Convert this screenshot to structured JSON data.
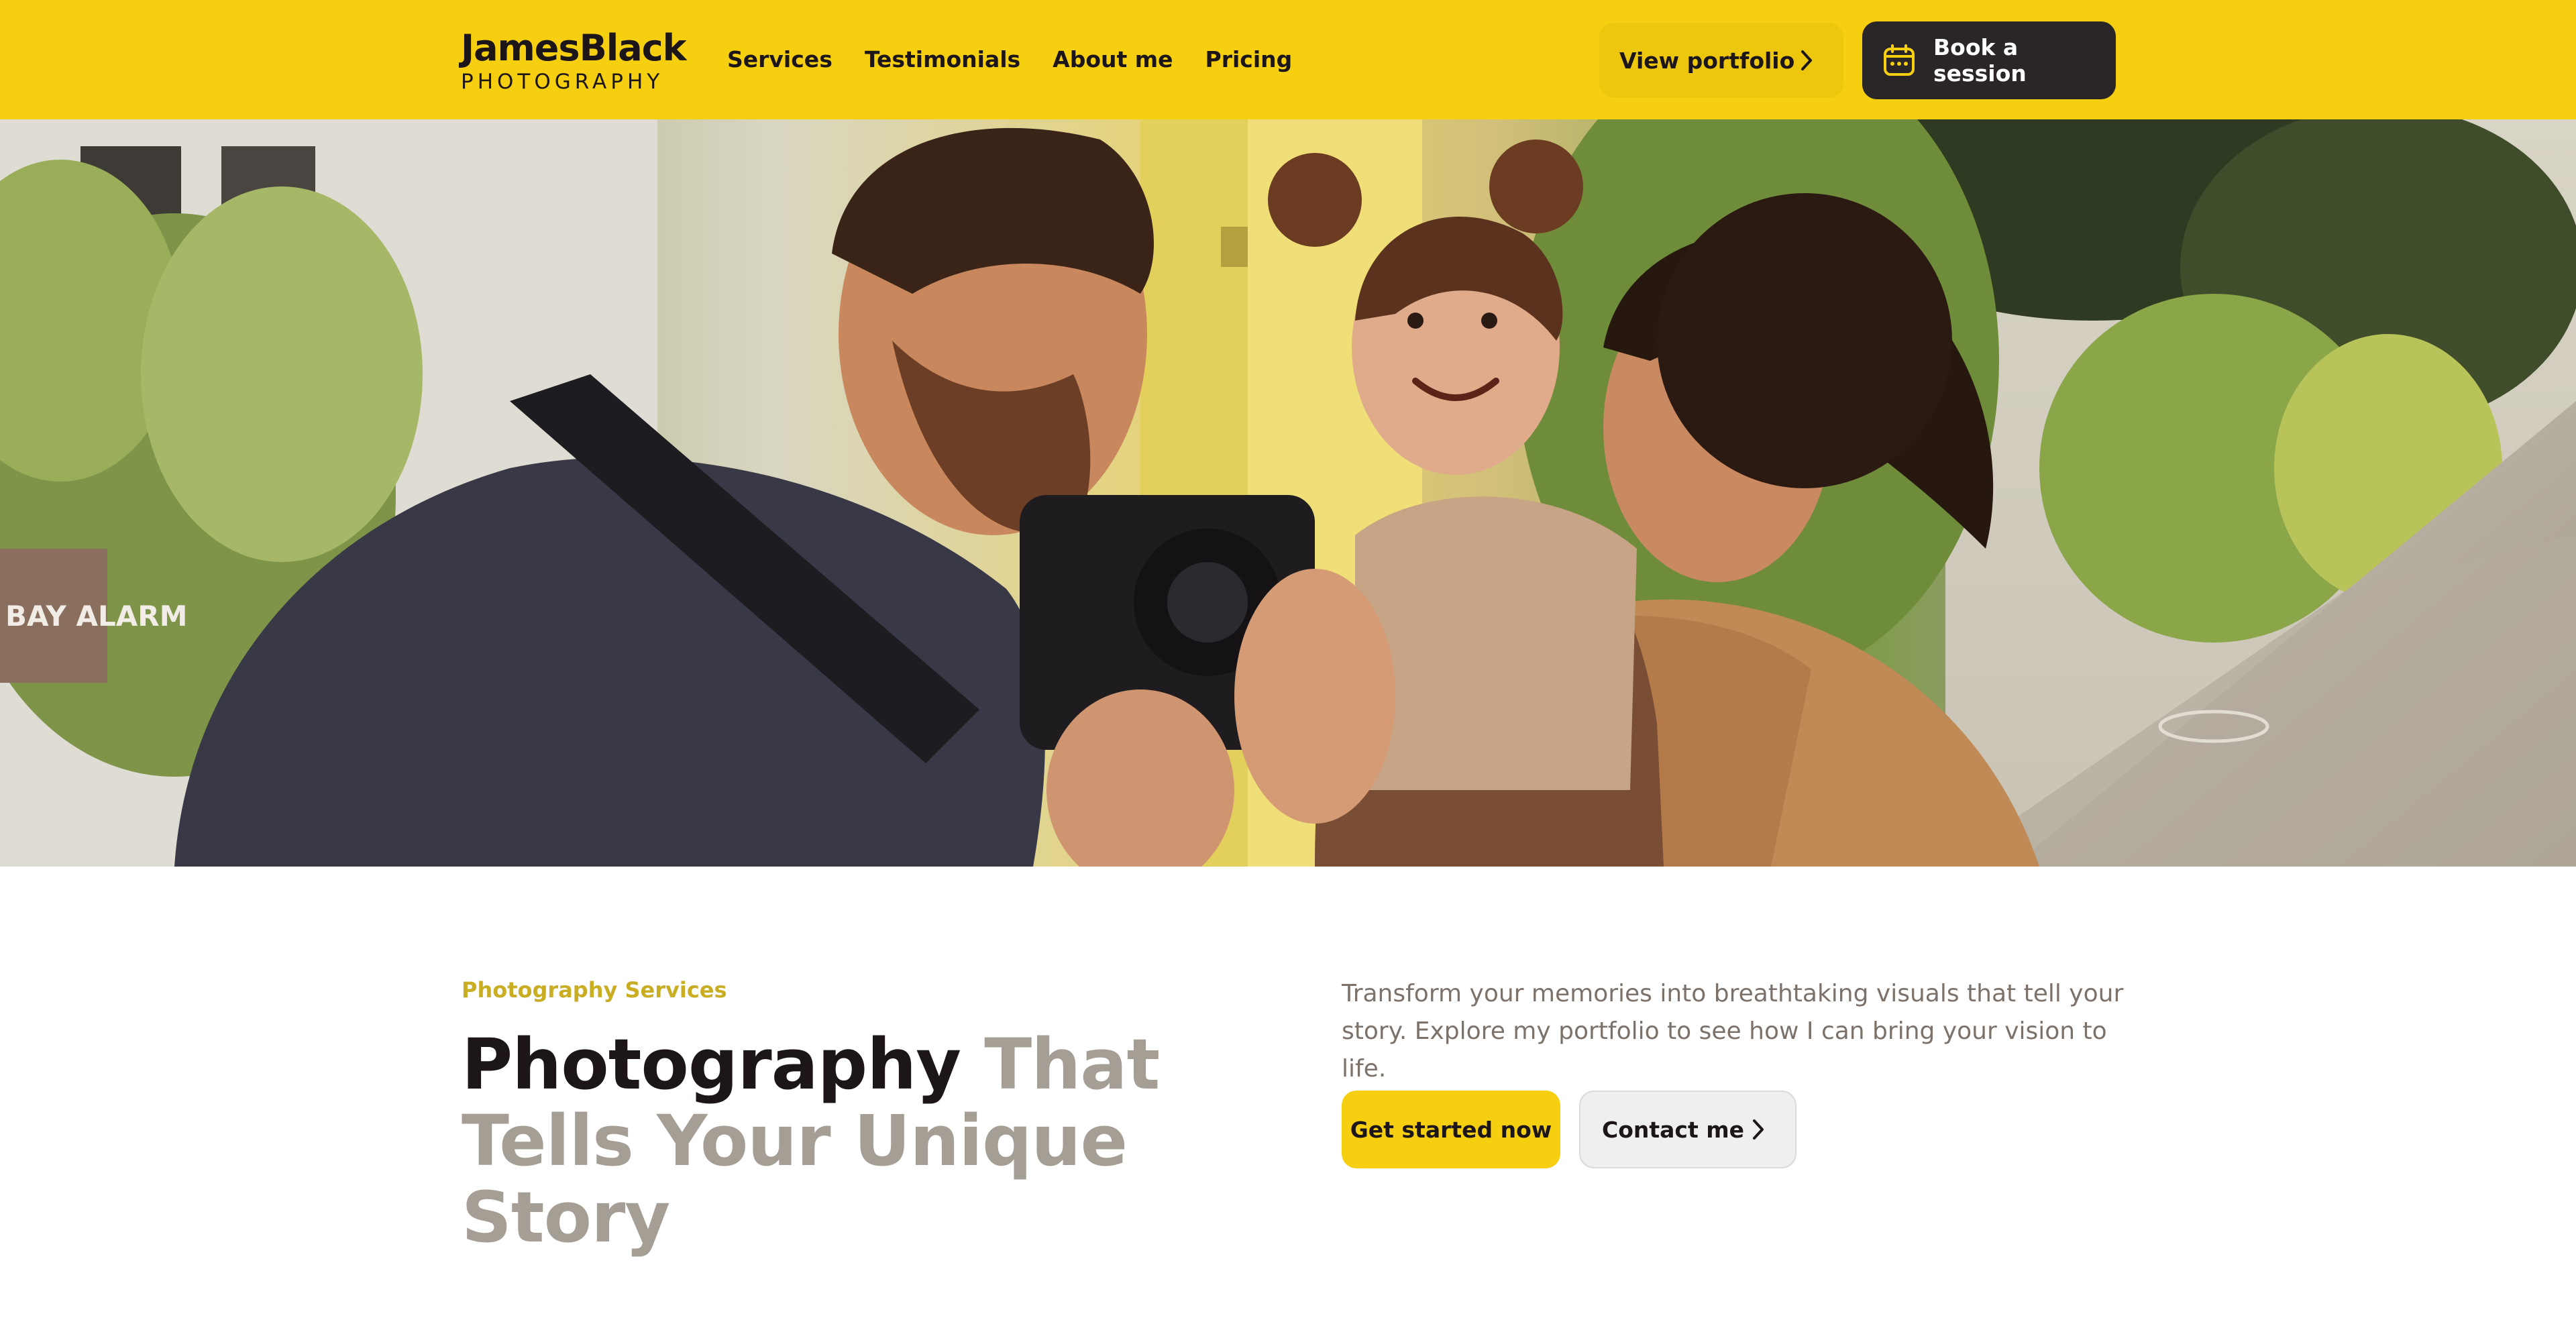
{
  "brand": {
    "name": "JamesBlack",
    "tagline": "PHOTOGRAPHY"
  },
  "nav": {
    "items": [
      {
        "label": "Services"
      },
      {
        "label": "Testimonials"
      },
      {
        "label": "About me"
      },
      {
        "label": "Pricing"
      }
    ]
  },
  "header_actions": {
    "portfolio_label": "View portfolio",
    "portfolio_icon": "chevron-right-icon",
    "book_label": "Book a session",
    "book_icon": "calendar-icon"
  },
  "hero": {
    "image_alt": "Photographer holding a camera photographing a smiling toddler held by her mother on a sunny sidewalk",
    "sign_text": "BAY ALARM"
  },
  "content": {
    "eyebrow": "Photography Services",
    "headline_dark": "Photography",
    "headline_muted": "That Tells Your Unique Story",
    "description": "Transform your memories into breathtaking visuals that tell your story. Explore my portfolio to see how I can bring your vision to life.",
    "primary_cta": "Get started now",
    "secondary_cta": "Contact me",
    "secondary_icon": "chevron-right-icon"
  },
  "colors": {
    "brand_yellow": "#f5cf10",
    "dark": "#2a2628",
    "eyebrow_gold": "#c9ad22",
    "muted_text": "#a59e95"
  }
}
